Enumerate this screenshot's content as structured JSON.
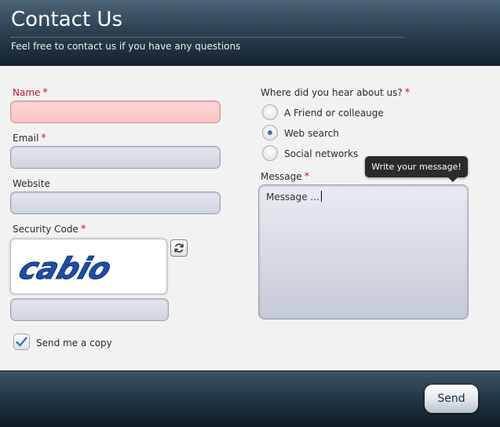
{
  "header": {
    "title": "Contact Us",
    "subtitle": "Feel free to contact us if you have any questions"
  },
  "form": {
    "name": {
      "label": "Name",
      "required": "*",
      "value": ""
    },
    "email": {
      "label": "Email",
      "required": "*",
      "value": ""
    },
    "website": {
      "label": "Website",
      "value": ""
    },
    "security": {
      "label": "Security Code",
      "required": "*",
      "captcha_text": "cabio",
      "value": ""
    },
    "copy": {
      "label": "Send me a copy",
      "checked": true
    },
    "hear_about": {
      "label": "Where did you hear about us?",
      "required": "*",
      "options": [
        {
          "label": "A Friend or colleauge",
          "selected": false
        },
        {
          "label": "Web search",
          "selected": true
        },
        {
          "label": "Social networks",
          "selected": false
        }
      ]
    },
    "message": {
      "label": "Message",
      "required": "*",
      "value": "Message ...",
      "tooltip": "Write your message!"
    }
  },
  "footer": {
    "send_label": "Send"
  },
  "colors": {
    "error_text": "#c0162b",
    "required_star": "#d0102a",
    "radio_selected": "#3a73c9",
    "captcha_ink": "#1b4fa8"
  }
}
